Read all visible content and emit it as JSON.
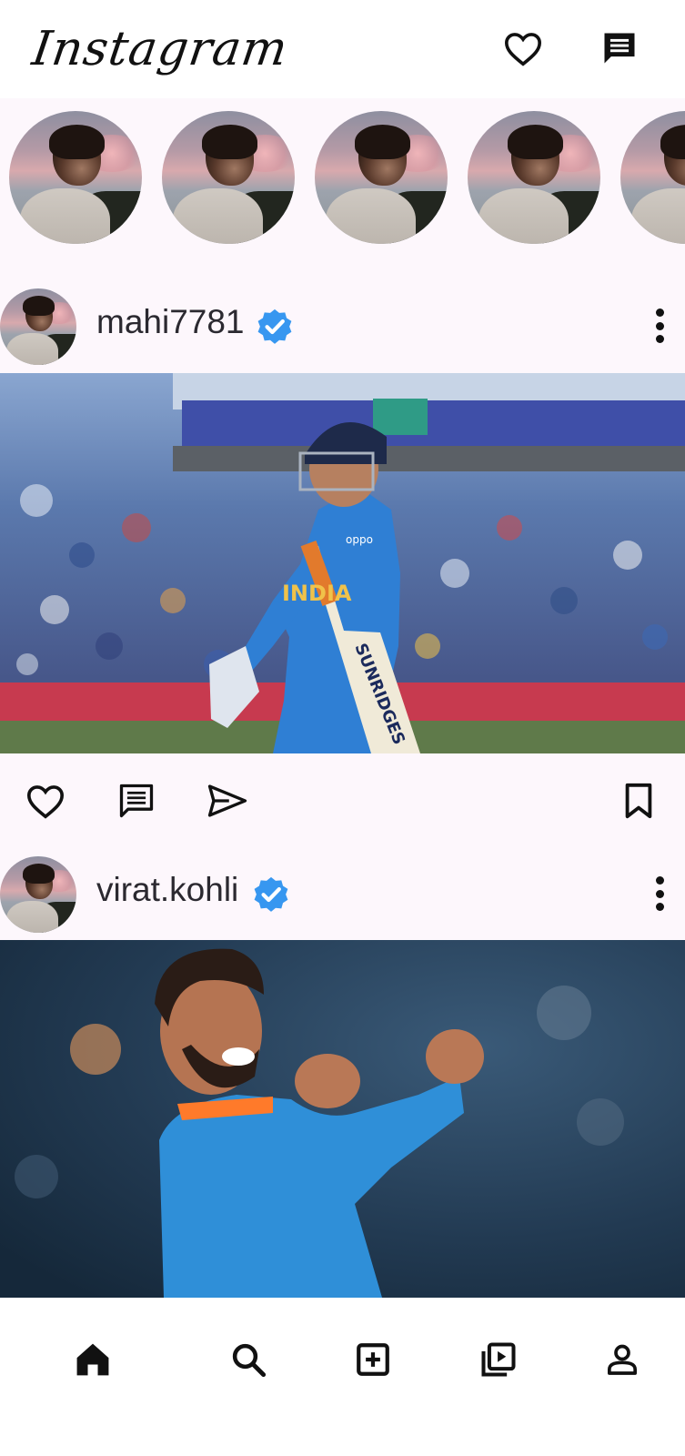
{
  "app": {
    "logo_text": "Instagram"
  },
  "header": {
    "icons": [
      "heart-outline-icon",
      "chat-message-icon"
    ]
  },
  "stories": {
    "count_visible": 5
  },
  "posts": [
    {
      "username": "mahi7781",
      "verified": true,
      "image_text": {
        "jersey": "INDIA",
        "bat": "SUNRIDGES",
        "sponsor": "oppo"
      }
    },
    {
      "username": "virat.kohli",
      "verified": true
    }
  ],
  "actions": [
    "like-icon",
    "comment-icon",
    "share-icon",
    "bookmark-icon"
  ],
  "bottom_nav": [
    "home-icon",
    "search-icon",
    "add-post-icon",
    "reels-icon",
    "profile-icon"
  ],
  "colors": {
    "background": "#fdf7fc",
    "verified_badge": "#3797f0",
    "icon": "#111111"
  }
}
